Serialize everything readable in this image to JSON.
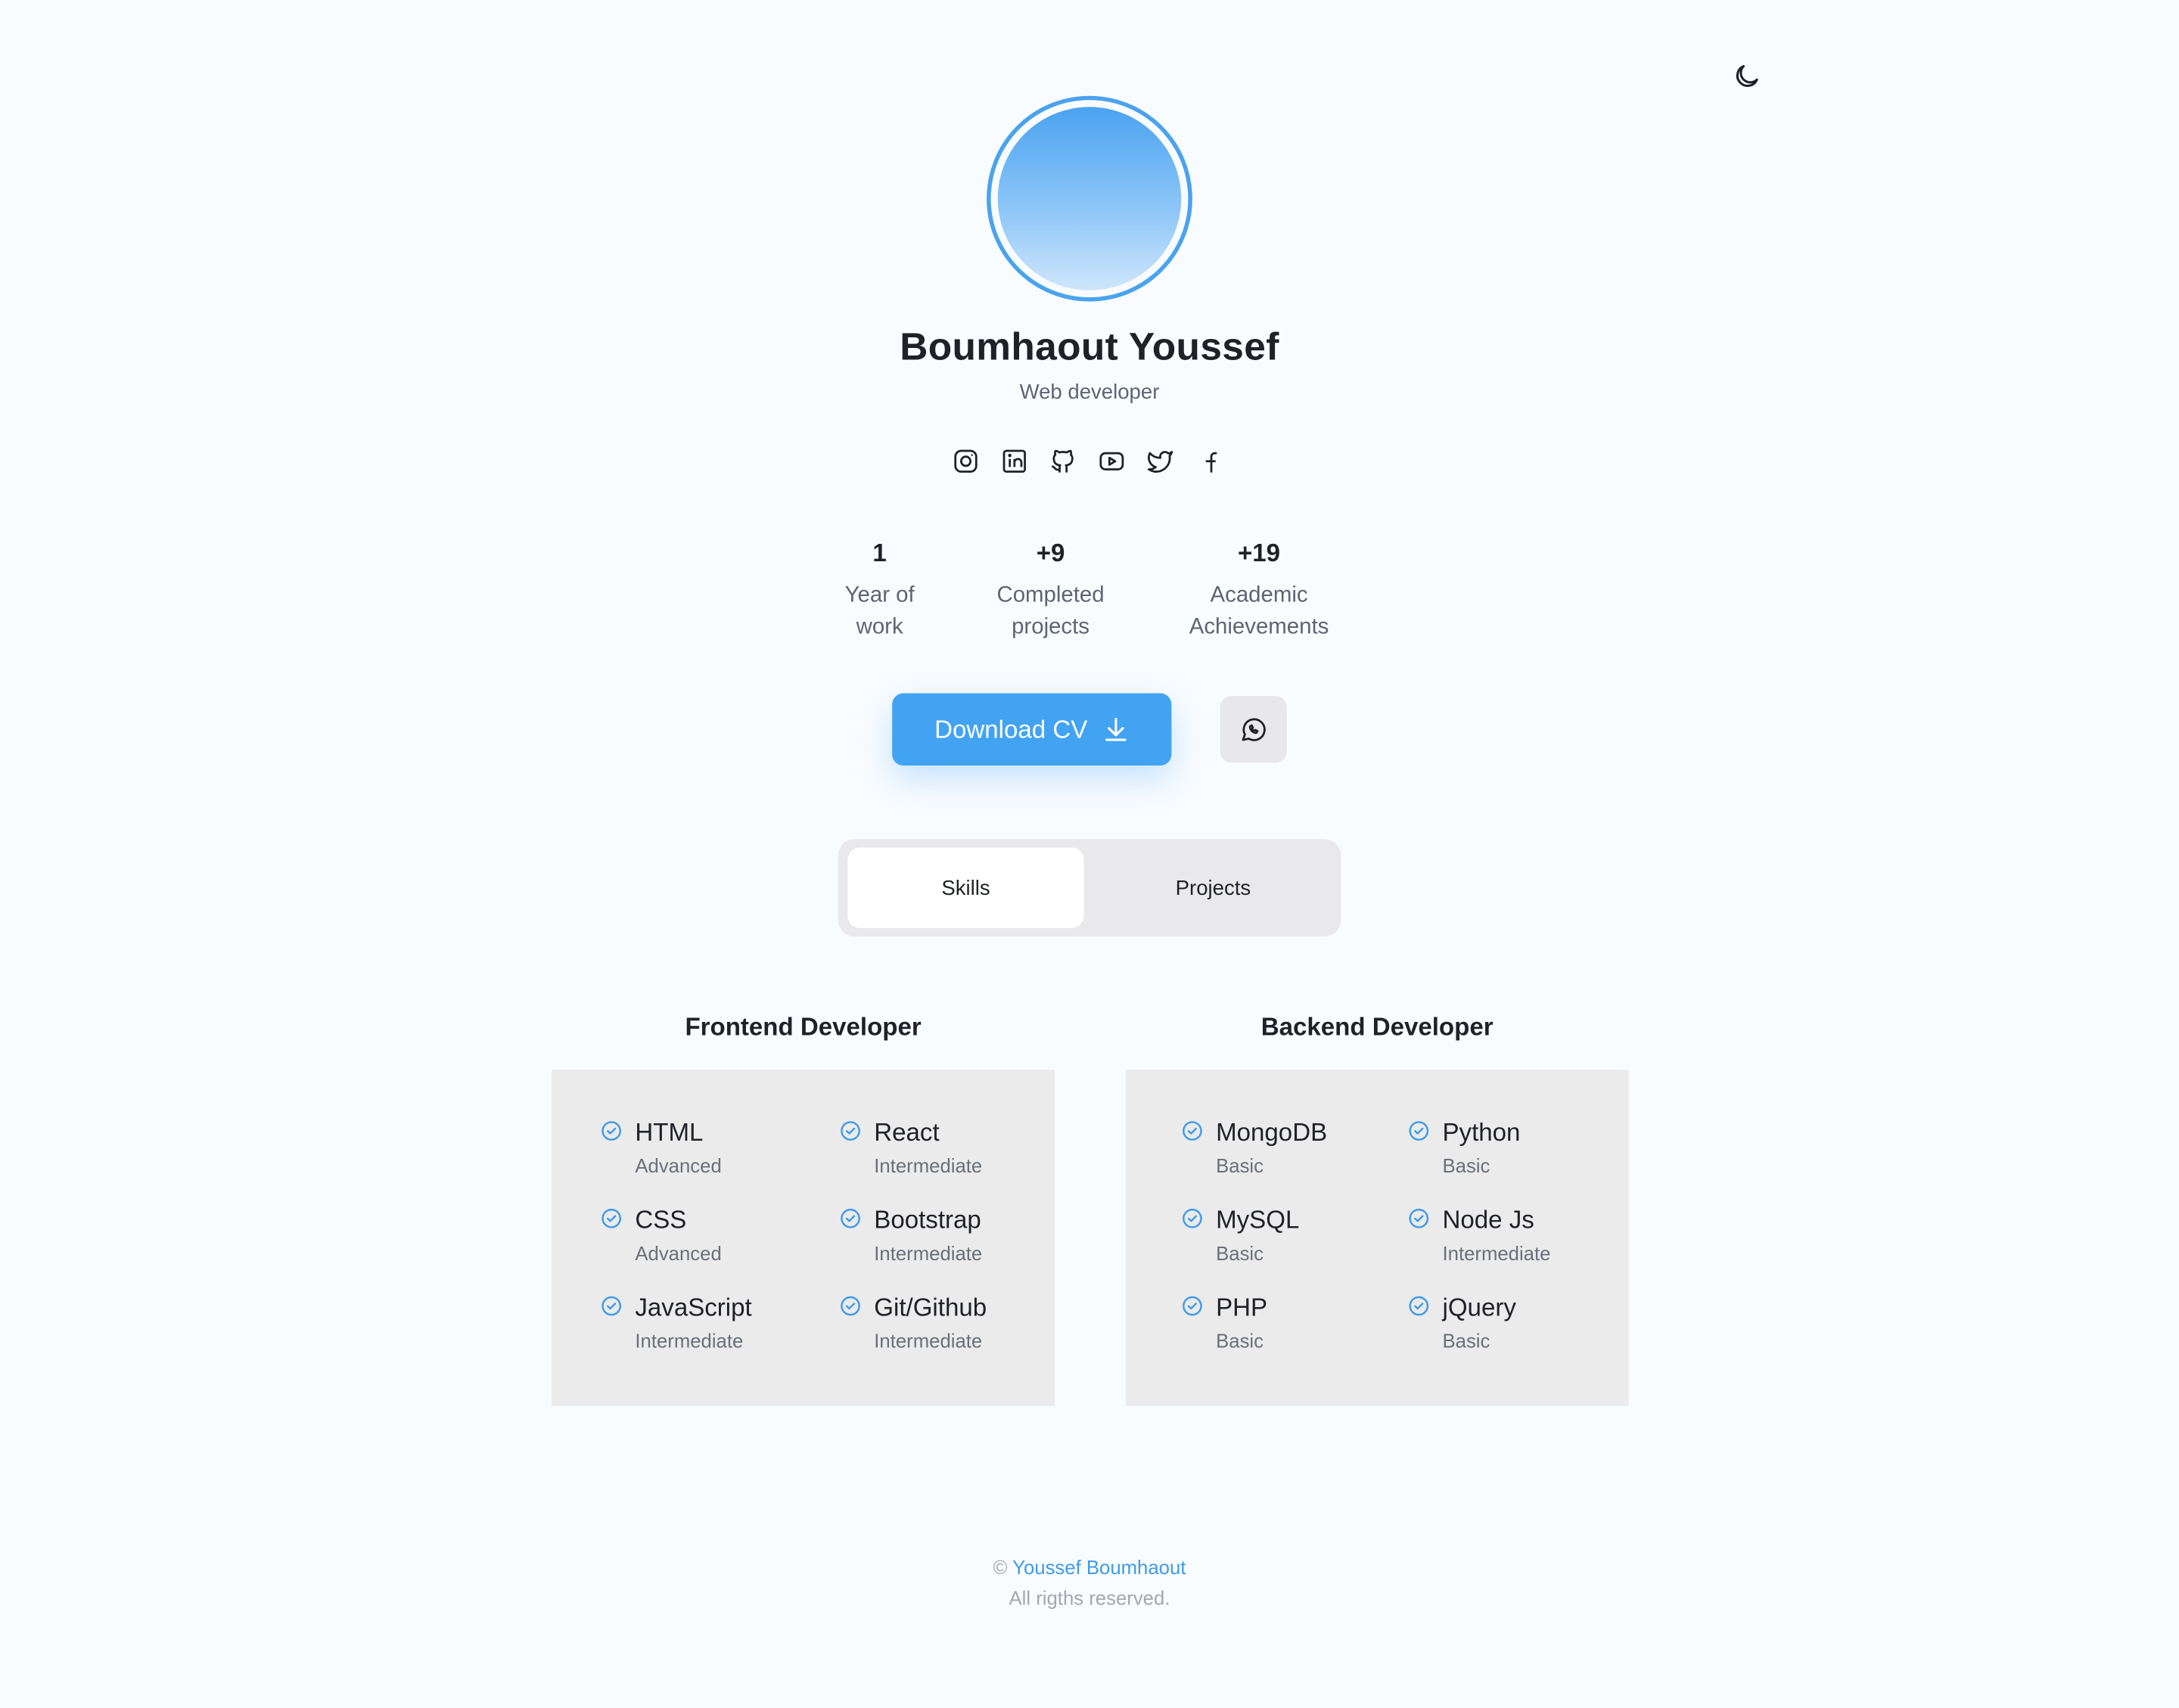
{
  "colors": {
    "accent": "#42a3f3",
    "background": "#f9fcff",
    "panel": "#ebebeb"
  },
  "header": {
    "theme_toggle_icon": "moon-icon"
  },
  "profile": {
    "name": "Boumhaout Youssef",
    "role": "Web developer"
  },
  "socials": [
    {
      "icon": "instagram-icon"
    },
    {
      "icon": "linkedin-icon"
    },
    {
      "icon": "github-icon"
    },
    {
      "icon": "youtube-icon"
    },
    {
      "icon": "twitter-icon"
    },
    {
      "icon": "facebook-icon"
    }
  ],
  "stats": [
    {
      "value": "1",
      "line1": "Year of",
      "line2": "work"
    },
    {
      "value": "+9",
      "line1": "Completed",
      "line2": "projects"
    },
    {
      "value": "+19",
      "line1": "Academic",
      "line2": "Achievements"
    }
  ],
  "actions": {
    "download_label": "Download CV",
    "download_icon": "download-icon",
    "whatsapp_icon": "whatsapp-icon"
  },
  "tabs": [
    {
      "label": "Skills",
      "active": true
    },
    {
      "label": "Projects",
      "active": false
    }
  ],
  "skills": {
    "frontend": {
      "title": "Frontend Developer",
      "items": [
        {
          "name": "HTML",
          "level": "Advanced"
        },
        {
          "name": "React",
          "level": "Intermediate"
        },
        {
          "name": "CSS",
          "level": "Advanced"
        },
        {
          "name": "Bootstrap",
          "level": "Intermediate"
        },
        {
          "name": "JavaScript",
          "level": "Intermediate"
        },
        {
          "name": "Git/Github",
          "level": "Intermediate"
        }
      ]
    },
    "backend": {
      "title": "Backend Developer",
      "items": [
        {
          "name": "MongoDB",
          "level": "Basic"
        },
        {
          "name": "Python",
          "level": "Basic"
        },
        {
          "name": "MySQL",
          "level": "Basic"
        },
        {
          "name": "Node Js",
          "level": "Intermediate"
        },
        {
          "name": "PHP",
          "level": "Basic"
        },
        {
          "name": "jQuery",
          "level": "Basic"
        }
      ]
    }
  },
  "footer": {
    "copyright_symbol": "©",
    "author": "Youssef Boumhaout",
    "rights": "All rigths reserved."
  }
}
